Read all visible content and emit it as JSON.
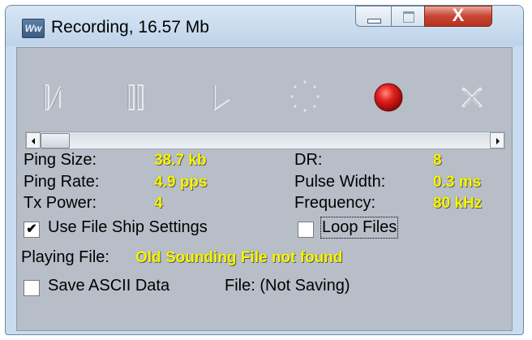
{
  "window": {
    "title": "Recording, 16.57 Mb",
    "app_icon_text": "Ww",
    "close_glyph": "X"
  },
  "toolbar": {
    "buttons": [
      {
        "name": "skip-to-start",
        "icon": "skip-start-icon",
        "enabled": false
      },
      {
        "name": "pause",
        "icon": "pause-icon",
        "enabled": false
      },
      {
        "name": "play",
        "icon": "play-icon",
        "enabled": false
      },
      {
        "name": "busy",
        "icon": "spinner-icon",
        "enabled": false
      },
      {
        "name": "record",
        "icon": "record-icon",
        "enabled": true,
        "color": "#d81b1b"
      },
      {
        "name": "stop",
        "icon": "close-x-icon",
        "enabled": false
      }
    ]
  },
  "scrollbar": {
    "position": 0
  },
  "stats": {
    "ping_size_label": "Ping Size:",
    "ping_size_value": "38.7 kb",
    "ping_rate_label": "Ping Rate:",
    "ping_rate_value": "4.9 pps",
    "tx_power_label": "Tx Power:",
    "tx_power_value": "4",
    "dr_label": "DR:",
    "dr_value": "8",
    "pulse_width_label": "Pulse Width:",
    "pulse_width_value": "0.3 ms",
    "frequency_label": "Frequency:",
    "frequency_value": "80 kHz"
  },
  "options": {
    "use_file_ship_label": "Use File Ship Settings",
    "use_file_ship_checked": true,
    "loop_files_label": "Loop Files",
    "loop_files_checked": false,
    "save_ascii_label": "Save ASCII Data",
    "save_ascii_checked": false
  },
  "playing": {
    "label": "Playing File:",
    "value": "Old Sounding File not found"
  },
  "file_status": "File: (Not Saving)",
  "colors": {
    "value_text": "#f7f700",
    "panel_bg": "#b7bec8",
    "record": "#d81b1b"
  }
}
